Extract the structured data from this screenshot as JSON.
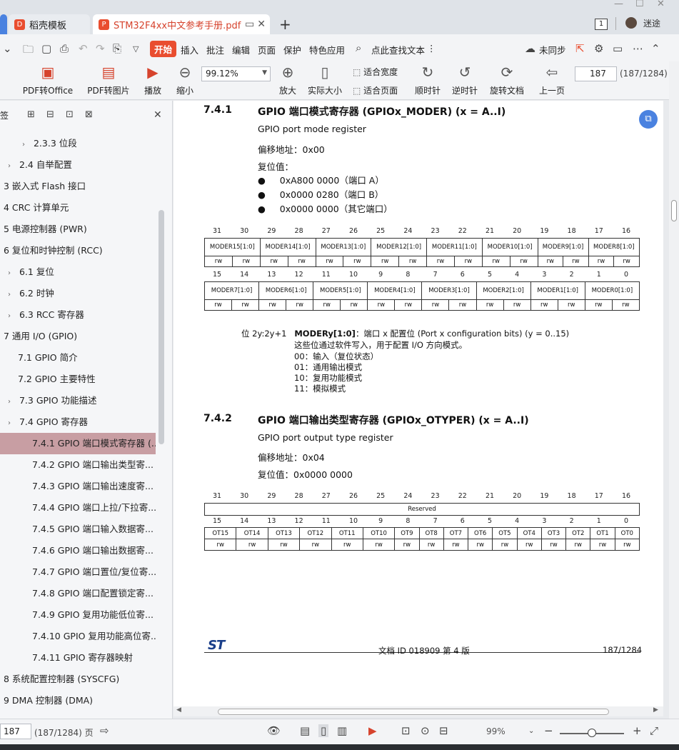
{
  "titlebar": {
    "tab_templates": "稻壳模板",
    "tab_doc": "STM32F4xx中文参考手册.pdf",
    "new_tab": "+",
    "badge": "1",
    "username": "迷途"
  },
  "menu": {
    "items": [
      "开始",
      "插入",
      "批注",
      "编辑",
      "页面",
      "保护",
      "特色应用"
    ],
    "search": "点此查找文本",
    "sync": "未同步"
  },
  "ribbon": {
    "pdf_to_office": "PDF转Office",
    "pdf_to_image": "PDF转图片",
    "play": "播放",
    "zoom_out": "缩小",
    "zoom_value": "99.12%",
    "zoom_in": "放大",
    "actual_size": "实际大小",
    "fit_width": "适合宽度",
    "fit_page": "适合页面",
    "rotate_cw": "顺时针",
    "rotate_ccw": "逆时针",
    "rotate_doc": "旋转文档",
    "prev_page": "上一页",
    "page_number": "187",
    "page_total": "(187/1284)"
  },
  "sidebar": {
    "label": "签",
    "items": [
      {
        "label": "2.3.3 位段",
        "indent": 2,
        "arrow": true,
        "selected": false
      },
      {
        "label": "2.4 自举配置",
        "indent": 1,
        "arrow": true,
        "selected": false
      },
      {
        "label": "3 嵌入式 Flash 接口",
        "indent": 0,
        "arrow": false,
        "selected": false
      },
      {
        "label": "4 CRC 计算单元",
        "indent": 0,
        "arrow": false,
        "selected": false
      },
      {
        "label": "5 电源控制器 (PWR)",
        "indent": 0,
        "arrow": false,
        "selected": false
      },
      {
        "label": "6 复位和时钟控制 (RCC)",
        "indent": 0,
        "arrow": false,
        "selected": false
      },
      {
        "label": "6.1 复位",
        "indent": 1,
        "arrow": true,
        "selected": false
      },
      {
        "label": "6.2 时钟",
        "indent": 1,
        "arrow": true,
        "selected": false
      },
      {
        "label": "6.3 RCC 寄存器",
        "indent": 1,
        "arrow": true,
        "selected": false
      },
      {
        "label": "7 通用 I/O (GPIO)",
        "indent": 0,
        "arrow": false,
        "selected": false
      },
      {
        "label": "7.1 GPIO 简介",
        "indent": 1,
        "arrow": false,
        "selected": false
      },
      {
        "label": "7.2 GPIO 主要特性",
        "indent": 1,
        "arrow": false,
        "selected": false
      },
      {
        "label": "7.3 GPIO 功能描述",
        "indent": 1,
        "arrow": true,
        "selected": false
      },
      {
        "label": "7.4 GPIO 寄存器",
        "indent": 1,
        "arrow": true,
        "selected": false
      },
      {
        "label": "7.4.1 GPIO 端口模式寄存器 (...",
        "indent": 2,
        "arrow": false,
        "selected": true
      },
      {
        "label": "7.4.2 GPIO 端口输出类型寄...",
        "indent": 2,
        "arrow": false,
        "selected": false
      },
      {
        "label": "7.4.3 GPIO 端口输出速度寄...",
        "indent": 2,
        "arrow": false,
        "selected": false
      },
      {
        "label": "7.4.4 GPIO 端口上拉/下拉寄...",
        "indent": 2,
        "arrow": false,
        "selected": false
      },
      {
        "label": "7.4.5 GPIO 端口输入数据寄...",
        "indent": 2,
        "arrow": false,
        "selected": false
      },
      {
        "label": "7.4.6 GPIO 端口输出数据寄...",
        "indent": 2,
        "arrow": false,
        "selected": false
      },
      {
        "label": "7.4.7 GPIO 端口置位/复位寄...",
        "indent": 2,
        "arrow": false,
        "selected": false
      },
      {
        "label": "7.4.8 GPIO 端口配置锁定寄...",
        "indent": 2,
        "arrow": false,
        "selected": false
      },
      {
        "label": "7.4.9 GPIO 复用功能低位寄...",
        "indent": 2,
        "arrow": false,
        "selected": false
      },
      {
        "label": "7.4.10 GPIO 复用功能高位寄...",
        "indent": 2,
        "arrow": false,
        "selected": false
      },
      {
        "label": "7.4.11 GPIO 寄存器映射",
        "indent": 2,
        "arrow": false,
        "selected": false
      },
      {
        "label": "8 系统配置控制器 (SYSCFG)",
        "indent": 0,
        "arrow": false,
        "selected": false
      },
      {
        "label": "9 DMA 控制器 (DMA)",
        "indent": 0,
        "arrow": false,
        "selected": false
      }
    ]
  },
  "doc": {
    "s1_num": "7.4.1",
    "s1_title": "GPIO 端口模式寄存器 (GPIOx_MODER) (x = A..I)",
    "s1_en": "GPIO port mode register",
    "s1_offset": "偏移地址：0x00",
    "s1_reset_label": "复位值：",
    "s1_reset_vals": [
      "0xA800 0000（端口 A）",
      "0x0000 0280（端口 B）",
      "0x0000 0000（其它端口）"
    ],
    "moder_hi_bits": [
      "31",
      "30",
      "29",
      "28",
      "27",
      "26",
      "25",
      "24",
      "23",
      "22",
      "21",
      "20",
      "19",
      "18",
      "17",
      "16"
    ],
    "moder_lo_bits": [
      "15",
      "14",
      "13",
      "12",
      "11",
      "10",
      "9",
      "8",
      "7",
      "6",
      "5",
      "4",
      "3",
      "2",
      "1",
      "0"
    ],
    "moder_hi": [
      "MODER15[1:0]",
      "MODER14[1:0]",
      "MODER13[1:0]",
      "MODER12[1:0]",
      "MODER11[1:0]",
      "MODER10[1:0]",
      "MODER9[1:0]",
      "MODER8[1:0]"
    ],
    "moder_lo": [
      "MODER7[1:0]",
      "MODER6[1:0]",
      "MODER5[1:0]",
      "MODER4[1:0]",
      "MODER3[1:0]",
      "MODER2[1:0]",
      "MODER1[1:0]",
      "MODER0[1:0]"
    ],
    "rw": "rw",
    "bits_desc": "位 2y:2y+1",
    "field_name": "MODERy[1:0]",
    "field_desc": "：端口 x 配置位 (Port x configuration bits) (y = 0..15)",
    "field_line2": "这些位通过软件写入，用于配置 I/O 方向模式。",
    "field_opts": [
      "00：输入（复位状态）",
      "01：通用输出模式",
      "10：复用功能模式",
      "11：模拟模式"
    ],
    "s2_num": "7.4.2",
    "s2_title": "GPIO 端口输出类型寄存器 (GPIOx_OTYPER) (x = A..I)",
    "s2_en": "GPIO port output type register",
    "s2_offset": "偏移地址：0x04",
    "s2_reset": "复位值：0x0000 0000",
    "reserved": "Reserved",
    "ot_lo": [
      "OT15",
      "OT14",
      "OT13",
      "OT12",
      "OT11",
      "OT10",
      "OT9",
      "OT8",
      "OT7",
      "OT6",
      "OT5",
      "OT4",
      "OT3",
      "OT2",
      "OT1",
      "OT0"
    ],
    "footer_logo": "ST",
    "footer_doc": "文档 ID 018909 第 4 版",
    "footer_page": "187/1284"
  },
  "status": {
    "page": "187",
    "total": "(187/1284) 页",
    "zoom": "99%"
  }
}
